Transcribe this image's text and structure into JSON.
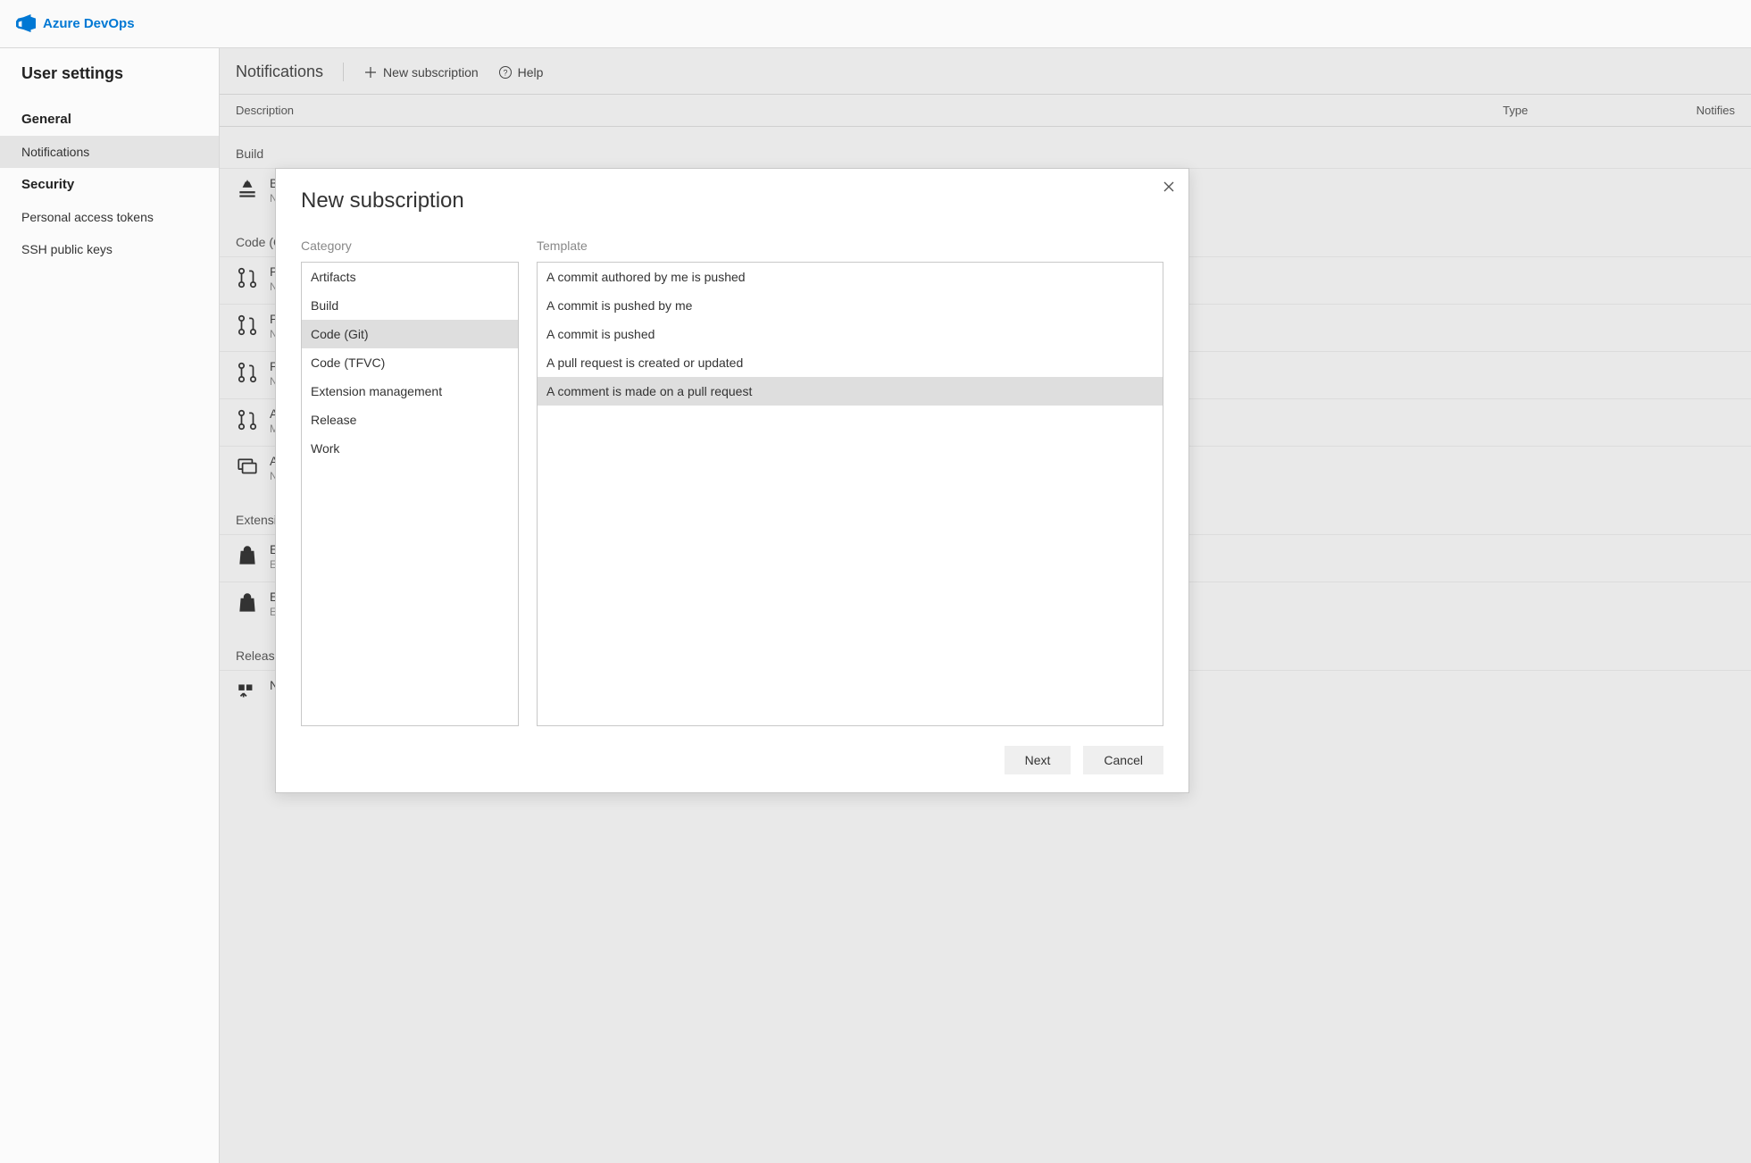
{
  "header": {
    "product_name": "Azure DevOps"
  },
  "sidebar": {
    "title": "User settings",
    "sections": [
      {
        "label": "General",
        "items": [
          {
            "label": "Notifications",
            "selected": true
          }
        ]
      },
      {
        "label": "Security",
        "items": [
          {
            "label": "Personal access tokens",
            "selected": false
          },
          {
            "label": "SSH public keys",
            "selected": false
          }
        ]
      }
    ]
  },
  "content": {
    "title": "Notifications",
    "actions": {
      "new_sub": "New subscription",
      "help": "Help"
    },
    "columns": {
      "description": "Description",
      "type": "Type",
      "notifies": "Notifies"
    },
    "groups": [
      {
        "label": "Build",
        "icon": "build",
        "rows": [
          {
            "title": "B",
            "sub": "N"
          }
        ]
      },
      {
        "label": "Code (G",
        "icon": "pull-request",
        "rows": [
          {
            "title": "P",
            "sub": "N"
          },
          {
            "title": "P",
            "sub": "N"
          },
          {
            "title": "P",
            "sub": "N"
          },
          {
            "title": "A",
            "sub": "M"
          },
          {
            "title": "A",
            "sub": "N",
            "icon": "comment"
          }
        ]
      },
      {
        "label": "Extensio",
        "icon": "bag",
        "rows": [
          {
            "title": "E",
            "sub": "E"
          },
          {
            "title": "E",
            "sub": "E"
          }
        ]
      },
      {
        "label": "Release",
        "icon": "release",
        "rows": [
          {
            "title": "N",
            "sub": ""
          }
        ]
      }
    ]
  },
  "modal": {
    "title": "New subscription",
    "category_label": "Category",
    "template_label": "Template",
    "categories": [
      {
        "label": "Artifacts",
        "selected": false
      },
      {
        "label": "Build",
        "selected": false
      },
      {
        "label": "Code (Git)",
        "selected": true
      },
      {
        "label": "Code (TFVC)",
        "selected": false
      },
      {
        "label": "Extension management",
        "selected": false
      },
      {
        "label": "Release",
        "selected": false
      },
      {
        "label": "Work",
        "selected": false
      }
    ],
    "templates": [
      {
        "label": "A commit authored by me is pushed",
        "selected": false
      },
      {
        "label": "A commit is pushed by me",
        "selected": false
      },
      {
        "label": "A commit is pushed",
        "selected": false
      },
      {
        "label": "A pull request is created or updated",
        "selected": false
      },
      {
        "label": "A comment is made on a pull request",
        "selected": true
      }
    ],
    "buttons": {
      "next": "Next",
      "cancel": "Cancel"
    }
  }
}
